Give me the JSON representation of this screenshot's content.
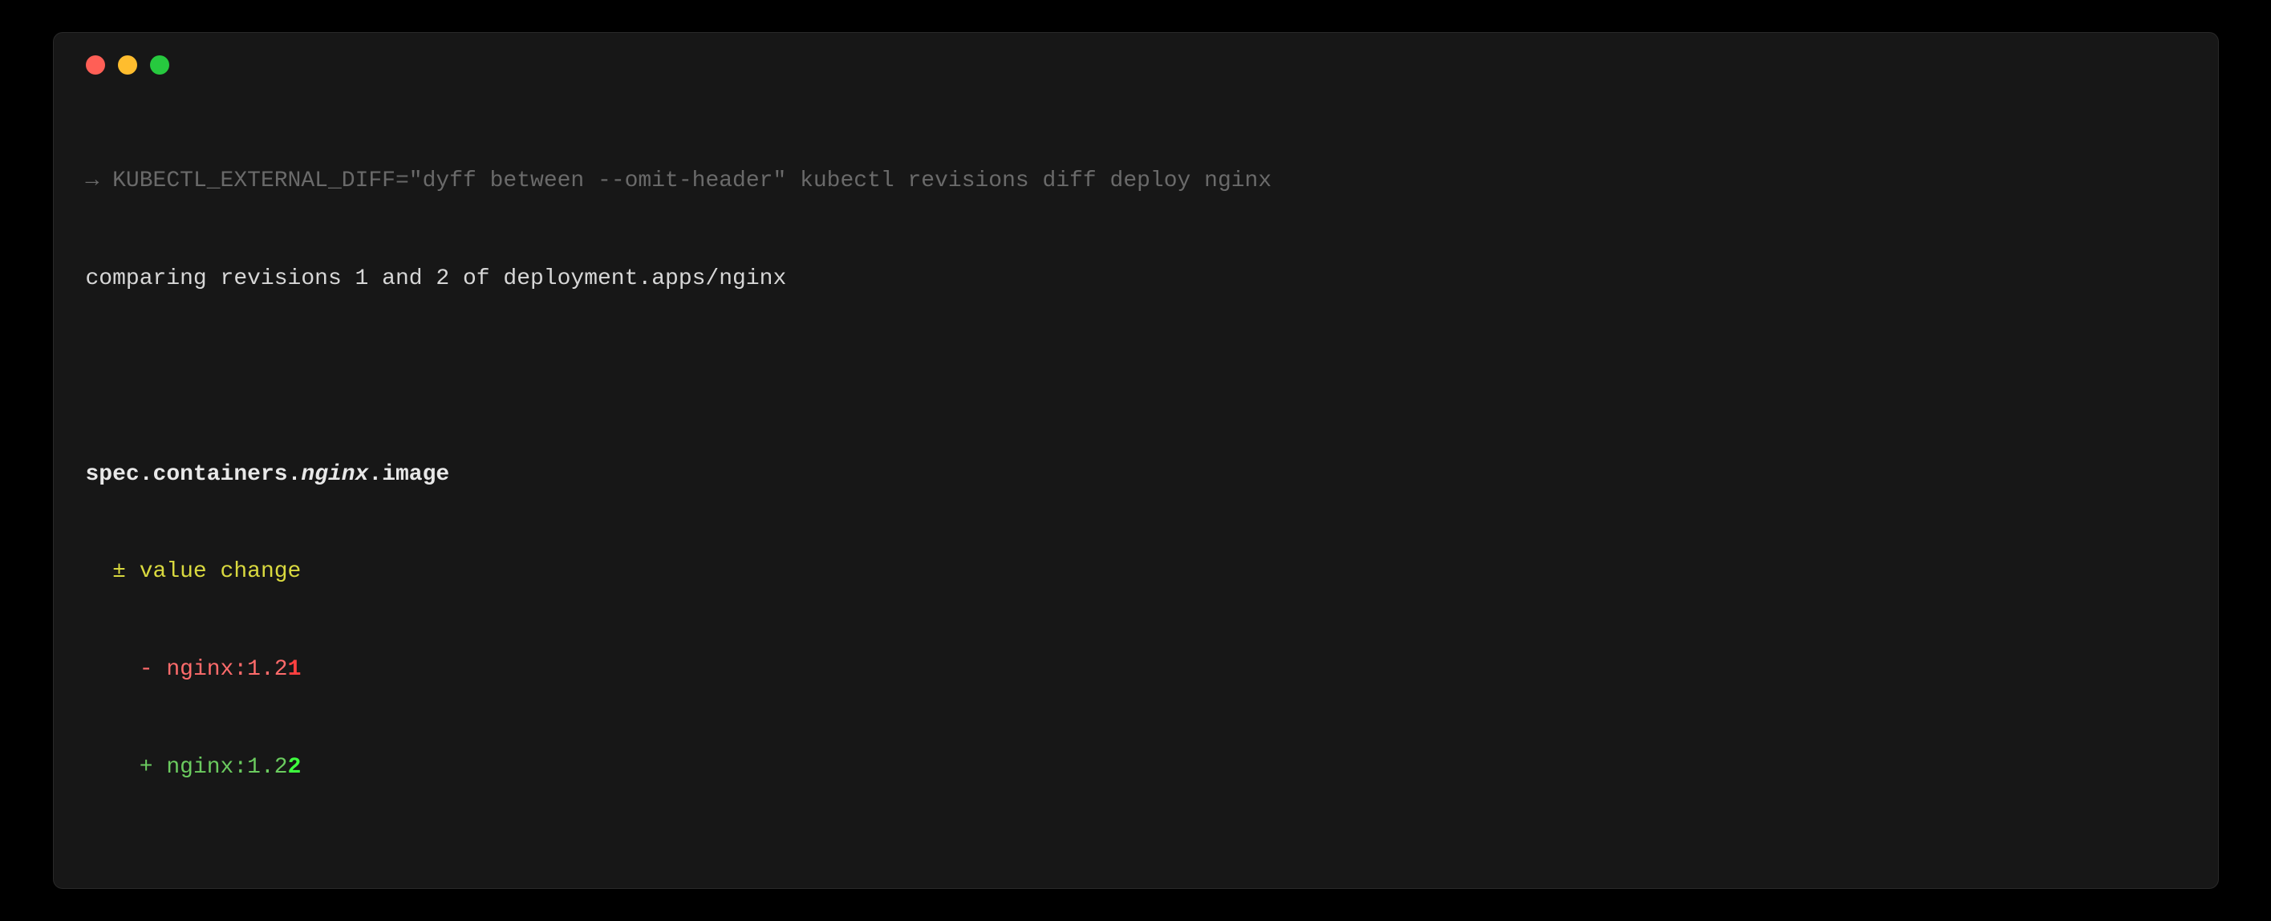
{
  "colors": {
    "background": "#000000",
    "terminal_bg": "#171717",
    "dot_red": "#ff5f56",
    "dot_yellow": "#ffbd2e",
    "dot_green": "#27c93f",
    "dim": "#6a6a6a",
    "text": "#d7d7d7",
    "bold_text": "#e8e8e8",
    "yellow": "#d9d93f",
    "red": "#ff6b6b",
    "red_bold": "#ff4040",
    "green": "#6bcb5f",
    "green_bold": "#3eff3e"
  },
  "prompt": {
    "arrow": "→",
    "command": "KUBECTL_EXTERNAL_DIFF=\"dyff between --omit-header\" kubectl revisions diff deploy nginx"
  },
  "output": {
    "comparing": "comparing revisions 1 and 2 of deployment.apps/nginx"
  },
  "path": {
    "p1": "spec",
    "dot1": ".",
    "p2": "containers",
    "dot2": ".",
    "p3": "nginx",
    "dot3": ".",
    "p4": "image"
  },
  "change": {
    "indent": "  ",
    "symbol": "±",
    "label": " value change"
  },
  "diff_minus": {
    "indent": "    ",
    "sign": "-",
    "space": " ",
    "prefix": "nginx:1.2",
    "changed": "1"
  },
  "diff_plus": {
    "indent": "    ",
    "sign": "+",
    "space": " ",
    "prefix": "nginx:1.2",
    "changed": "2"
  }
}
